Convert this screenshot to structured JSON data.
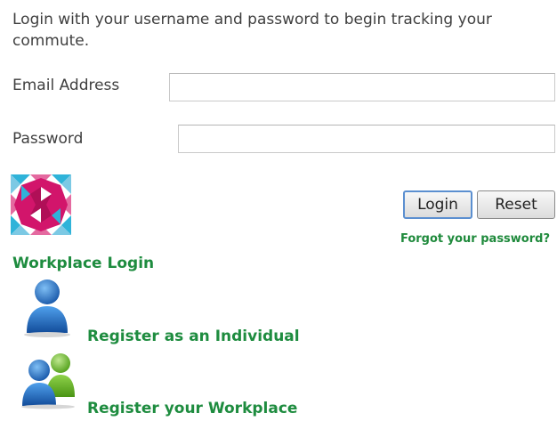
{
  "intro_text": "Login with your username and password to begin tracking your commute.",
  "form": {
    "email_label": "Email Address",
    "email_value": "",
    "password_label": "Password",
    "password_value": ""
  },
  "buttons": {
    "login_label": "Login",
    "reset_label": "Reset"
  },
  "links": {
    "forgot_password": "Forgot your password?",
    "workplace_login": "Workplace Login",
    "register_individual": "Register as an Individual",
    "register_workplace": "Register your Workplace"
  },
  "icons": {
    "logo": "quilt-star-logo",
    "individual": "single-person-icon",
    "workplace": "two-people-icon"
  },
  "colors": {
    "link_green": "#1e8c3f",
    "logo_magenta": "#d2156b",
    "logo_cyan": "#2fb3d9",
    "person_blue": "#1f74c8",
    "person_green": "#6cbf2a"
  }
}
